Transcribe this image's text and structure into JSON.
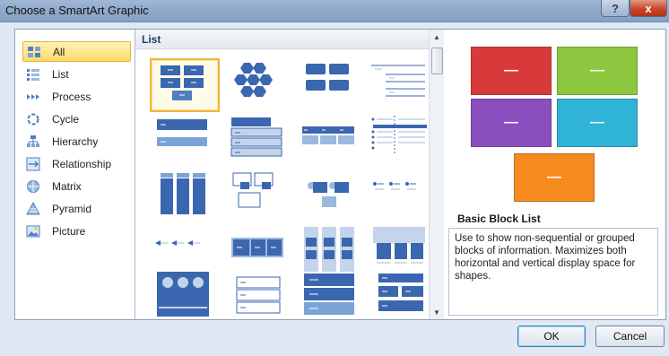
{
  "window": {
    "title": "Choose a SmartArt Graphic",
    "help_label": "?",
    "close_label": "x"
  },
  "categories": [
    {
      "label": "All",
      "icon": "all-icon",
      "selected": true
    },
    {
      "label": "List",
      "icon": "list-icon"
    },
    {
      "label": "Process",
      "icon": "process-icon"
    },
    {
      "label": "Cycle",
      "icon": "cycle-icon"
    },
    {
      "label": "Hierarchy",
      "icon": "hierarchy-icon"
    },
    {
      "label": "Relationship",
      "icon": "relationship-icon"
    },
    {
      "label": "Matrix",
      "icon": "matrix-icon"
    },
    {
      "label": "Pyramid",
      "icon": "pyramid-icon"
    },
    {
      "label": "Picture",
      "icon": "picture-icon"
    }
  ],
  "gallery": {
    "heading": "List"
  },
  "preview": {
    "title": "Basic Block List",
    "description": "Use to show non-sequential or grouped blocks of information. Maximizes both horizontal and vertical display space for shapes.",
    "block_colors": [
      "#d83a3a",
      "#8dc63f",
      "#8a4fbf",
      "#2fb3d6",
      "#f58a1f"
    ],
    "block_label": "—"
  },
  "buttons": {
    "ok": "OK",
    "cancel": "Cancel"
  }
}
